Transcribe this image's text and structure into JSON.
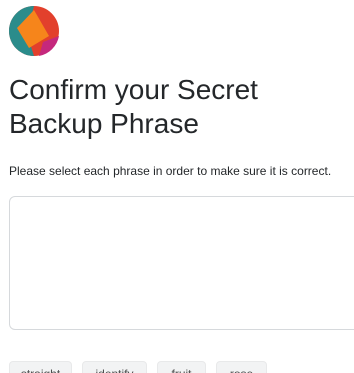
{
  "header": {
    "logo_icon": "metamask-fox-icon"
  },
  "page": {
    "title": "Confirm your Secret Backup Phrase",
    "subtitle": "Please select each phrase in order to make sure it is correct."
  },
  "word_chips": [
    {
      "label": "straight"
    },
    {
      "label": "identify"
    },
    {
      "label": "fruit"
    },
    {
      "label": "rose"
    }
  ],
  "colors": {
    "logo_orange": "#f6851b",
    "logo_red": "#e2402c",
    "logo_teal": "#2b8c8b",
    "logo_magenta": "#c5287d",
    "text": "#24272a",
    "border": "#d6d9dc"
  }
}
